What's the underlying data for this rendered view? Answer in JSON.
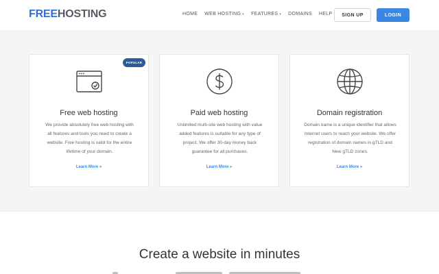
{
  "header": {
    "logo_part1": "FREE",
    "logo_part2": "HOSTING",
    "nav": [
      {
        "label": "HOME",
        "dropdown": false
      },
      {
        "label": "WEB HOSTING",
        "dropdown": true
      },
      {
        "label": "FEATURES",
        "dropdown": true
      },
      {
        "label": "DOMAINS",
        "dropdown": false
      },
      {
        "label": "HELP",
        "dropdown": true
      }
    ],
    "signup_label": "SIGN UP",
    "login_label": "LOGIN"
  },
  "plans": [
    {
      "title": "Free web hosting",
      "description": "We provide absolutely free web hosting with all features and tools you need to create a website. Free hosting is valid for the entire lifetime of your domain.",
      "link": "Learn More »",
      "badge": "POPULAR",
      "icon": "browser-check-icon"
    },
    {
      "title": "Paid web hosting",
      "description": "Unlimited multi-site web hosting with value added features is suitable for any type of project. We offer 30-day money back guarantee for all purchases.",
      "link": "Learn More »",
      "icon": "dollar-circle-icon"
    },
    {
      "title": "Domain registration",
      "description": "Domain name is a unique identifier that allows Internet users to reach your website. We offer registration of domain names in gTLD and New gTLD zones.",
      "link": "Learn More »",
      "icon": "globe-icon"
    }
  ],
  "bottom": {
    "title": "Create a website in minutes"
  },
  "colors": {
    "accent": "#3b86e0",
    "badge": "#2c5a9a",
    "logo_blue": "#2f6fd1"
  }
}
